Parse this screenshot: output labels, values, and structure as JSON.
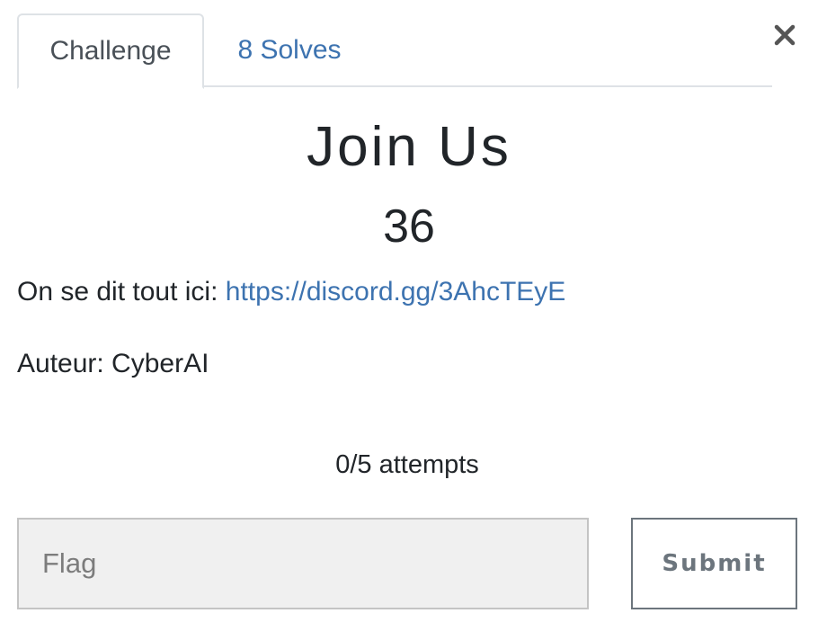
{
  "tabs": [
    {
      "label": "Challenge",
      "active": true
    },
    {
      "label": "8 Solves",
      "active": false
    }
  ],
  "challenge": {
    "name": "Join Us",
    "value": "36",
    "description_prefix": "On se dit tout ici: ",
    "description_link": "https://discord.gg/3AhcTEyE",
    "author": "Auteur: CyberAI"
  },
  "attempts": "0/5 attempts",
  "flag_input": {
    "placeholder": "Flag",
    "value": ""
  },
  "submit_label": "Submit",
  "close_icon": "close-icon",
  "colors": {
    "link": "#3d73b0",
    "text": "#212529",
    "input_bg": "#f0f0f0",
    "button_border": "#6c757d"
  }
}
